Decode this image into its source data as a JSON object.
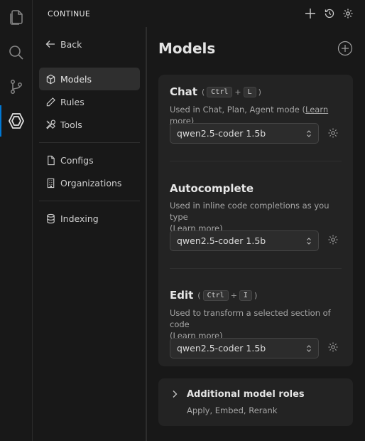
{
  "activity_bar": {
    "items": [
      {
        "icon": "files-icon"
      },
      {
        "icon": "search-icon"
      },
      {
        "icon": "source-control-icon"
      },
      {
        "icon": "continue-icon",
        "active": true
      }
    ]
  },
  "header": {
    "title": "CONTINUE"
  },
  "nav": {
    "back_label": "Back",
    "items": [
      {
        "label": "Models",
        "icon": "cube-icon"
      },
      {
        "label": "Rules",
        "icon": "pencil-icon"
      },
      {
        "label": "Tools",
        "icon": "tools-icon"
      },
      {
        "label": "Configs",
        "icon": "file-icon"
      },
      {
        "label": "Organizations",
        "icon": "building-icon"
      },
      {
        "label": "Indexing",
        "icon": "database-icon"
      }
    ]
  },
  "main": {
    "title": "Models",
    "chat": {
      "title": "Chat",
      "key1": "Ctrl",
      "plus": "+",
      "key2": "L",
      "description": "Used in Chat, Plan, Agent mode",
      "learn_more": "Learn more",
      "model": "qwen2.5-coder 1.5b"
    },
    "autocomplete": {
      "title": "Autocomplete",
      "description": "Used in inline code completions as you type",
      "learn_more": "Learn more",
      "model": "qwen2.5-coder 1.5b"
    },
    "edit": {
      "title": "Edit",
      "key1": "Ctrl",
      "plus": "+",
      "key2": "I",
      "description": "Used to transform a selected section of code",
      "learn_more": "Learn more",
      "model": "qwen2.5-coder 1.5b"
    },
    "additional": {
      "title": "Additional model roles",
      "subtitle": "Apply, Embed, Rerank"
    }
  }
}
